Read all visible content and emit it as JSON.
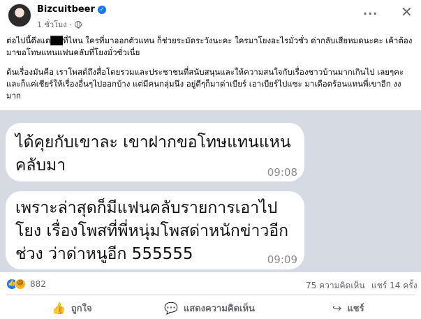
{
  "post": {
    "author": "Bizcuitbeer",
    "timestamp": "1 ชั่วโมง",
    "paragraph1": "ต่อไปนี้ดึงแด██ที่ไหน ใครที่มาออกตัวแทน ก็ช่วยระมัดระวังนะคะ ใครมาโยงอะไรมั่วซั่ว ด่ากลับเสียหมดนะคะ เค้าต้องมาขอโทษแทนแฟนคลับที่โยงมั่วซั่วเนี่ย",
    "paragraph2": "ต้นเรื่องมันคือ เราโพสต์ถึงสื่อโดยรวมและประชาชนที่สนับสนุนและให้ความสนใจกับเรื่องชาวบ้านมากเกินไป เลยๆคะ และก็แค่เชียร์ให้เรื่องอื่นๆไปออกบ้าง แต่มีคนกลุ่มนึง อยู่ดีๆก็มาด่าเบียร์ เอาเบียร์ไปแซะ มาเดือดร้อนแทนพี่เขาอีก งงมาก"
  },
  "chat": {
    "bubble1_text": "ได้คุยกับเขาละ เขาฝากขอโทษแทนแหนคลับมา",
    "bubble1_time": "09:08",
    "bubble2_text": "เพราะล่าสุดก็มีแฟนคลับรายการเอาไปโยง เรื่องโพสที่พี่หนุ่มโพสด่าหนักข่าวอีกช่วง ว่าด่าหนูอีก 555555",
    "bubble2_time": "09:09"
  },
  "stats": {
    "reaction_count": "882",
    "comments": "75 ความคิดเห็น",
    "shares": "แชร์ 14 ครั้ง"
  },
  "actions": {
    "like_label": "ถูกใจ",
    "comment_label": "แสดงความคิดเห็น",
    "share_label": "แชร์"
  },
  "icons": {
    "verified": "verified-badge-icon",
    "globe": "globe-icon",
    "more": "more-options-icon",
    "close": "close-icon",
    "like": "thumbs-up-icon",
    "comment": "comment-bubble-icon",
    "share": "share-arrow-icon"
  },
  "colors": {
    "brand_blue": "#1877f2",
    "muted_text": "#65676b",
    "chat_background": "#d6dbe3"
  }
}
